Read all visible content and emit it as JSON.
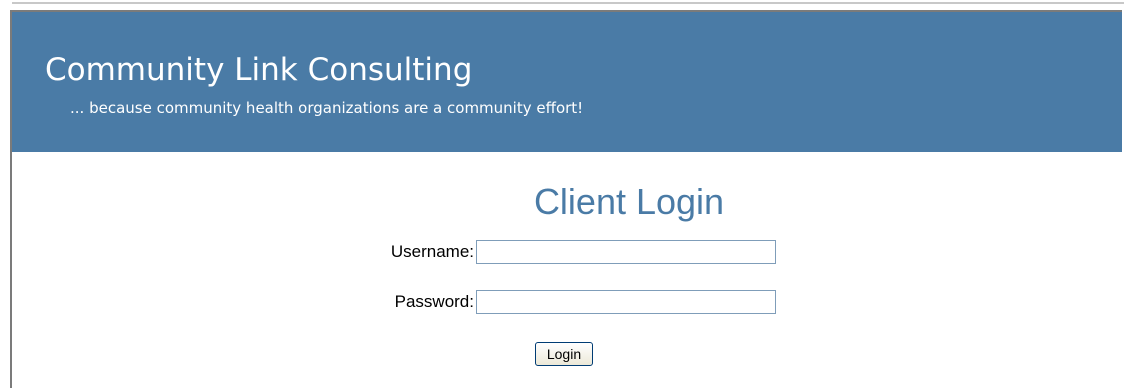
{
  "header": {
    "title": "Community Link Consulting",
    "tagline": "... because community health organizations are a community effort!",
    "background_color": "#4a7ba6"
  },
  "login": {
    "title": "Client Login",
    "title_color": "#4a7ba6",
    "username_label": "Username:",
    "username_value": "",
    "password_label": "Password:",
    "password_value": "",
    "submit_label": "Login"
  }
}
